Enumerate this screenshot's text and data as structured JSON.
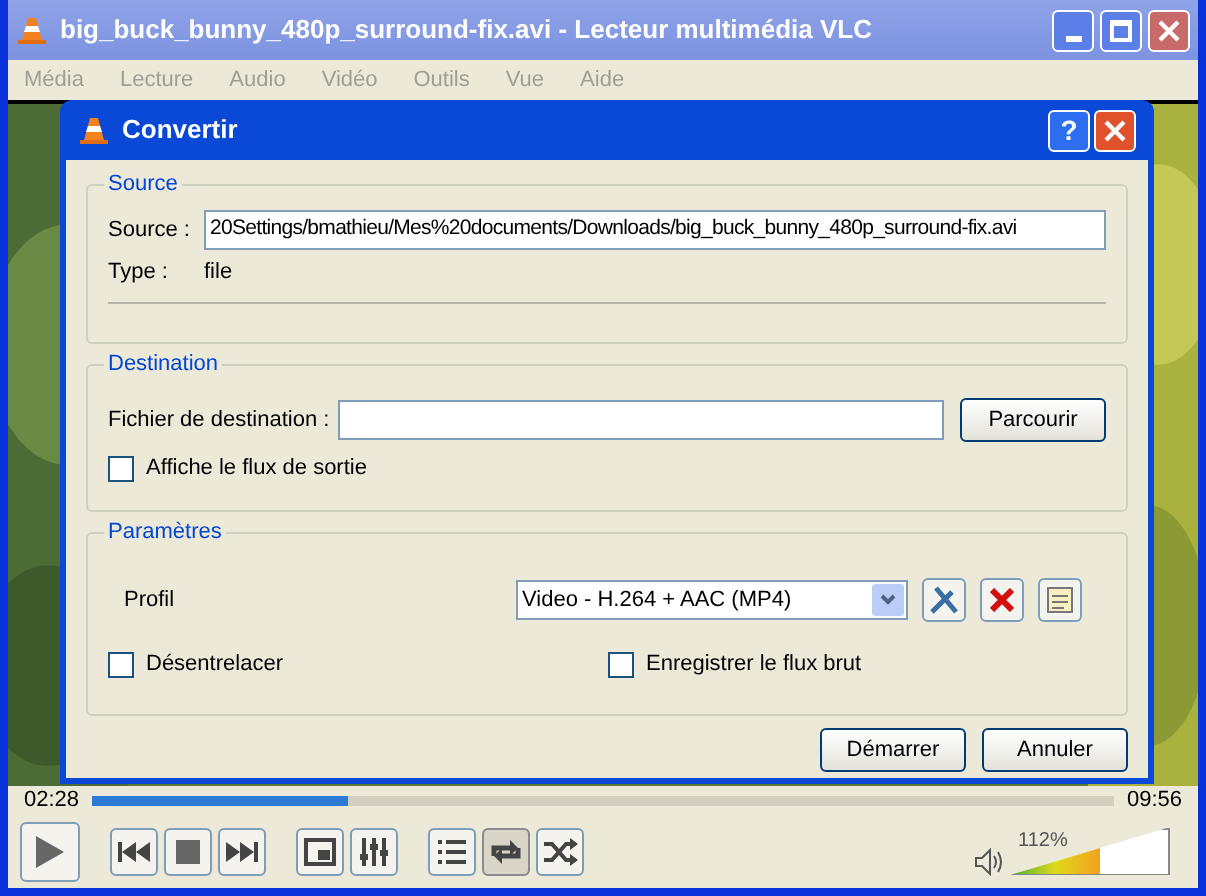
{
  "window": {
    "title": "big_buck_bunny_480p_surround-fix.avi - Lecteur multimédia VLC"
  },
  "menu": [
    "Média",
    "Lecture",
    "Audio",
    "Vidéo",
    "Outils",
    "Vue",
    "Aide"
  ],
  "dialog": {
    "title": "Convertir",
    "help": "?",
    "source": {
      "heading": "Source",
      "label": "Source :",
      "value": "20Settings/bmathieu/Mes%20documents/Downloads/big_buck_bunny_480p_surround-fix.avi",
      "type_label": "Type :",
      "type_value": "file"
    },
    "destination": {
      "heading": "Destination",
      "label": "Fichier de destination :",
      "browse": "Parcourir",
      "show_output": {
        "label": "Affiche le flux de sortie",
        "checked": false
      }
    },
    "settings": {
      "heading": "Paramètres",
      "profile_label": "Profil",
      "profile_value": "Video - H.264 + AAC (MP4)",
      "deinterlace": {
        "label": "Désentrelacer",
        "checked": false
      },
      "dump_raw": {
        "label": "Enregistrer le flux brut",
        "checked": false
      }
    },
    "buttons": [
      "Démarrer",
      "Annuler"
    ]
  },
  "seek": {
    "elapsed": "02:28",
    "total": "09:56",
    "level": 0.25
  },
  "controls": [
    {
      "kind": "play",
      "pressed": false
    },
    {
      "kind": "prev",
      "pressed": false
    },
    {
      "kind": "stop",
      "pressed": false
    },
    {
      "kind": "next",
      "pressed": false
    },
    {
      "kind": "fullscreen",
      "pressed": false
    },
    {
      "kind": "effects",
      "pressed": false
    },
    {
      "kind": "playlist",
      "pressed": false
    },
    {
      "kind": "loop",
      "pressed": true
    },
    {
      "kind": "random",
      "pressed": false
    }
  ],
  "volume": {
    "reading": "112%",
    "level": 0.56
  }
}
